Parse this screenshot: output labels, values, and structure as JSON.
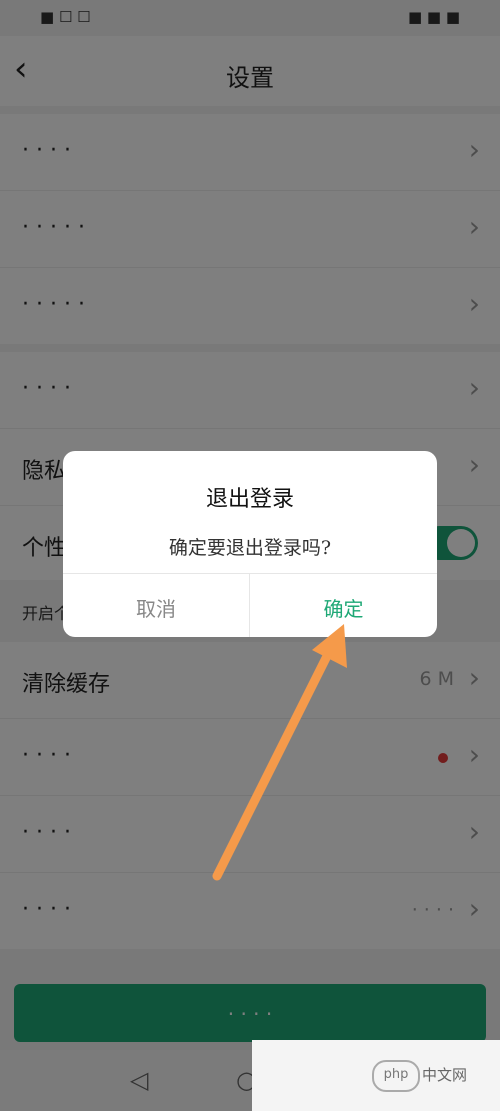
{
  "statusbar": {
    "carrier": "■ ☐ ☐",
    "right": "■ ■ ■"
  },
  "topbar": {
    "title": "设置",
    "back_glyph": "‹"
  },
  "groups": [
    {
      "items": [
        {
          "label": "· · · ·",
          "chevron": "›"
        },
        {
          "label": "· · · · ·",
          "chevron": "›"
        },
        {
          "label": "· · · · ·",
          "chevron": "›"
        }
      ]
    },
    {
      "items": [
        {
          "label": "· · · ·",
          "chevron": "›"
        },
        {
          "label": "隐私",
          "chevron": "›"
        },
        {
          "label": "个性",
          "toggle_on": true
        }
      ]
    }
  ],
  "note": {
    "text": "开启个"
  },
  "cache": {
    "label": "清除缓存",
    "value": "6 M",
    "chevron": "›"
  },
  "groups2": [
    {
      "label": "· · · ·",
      "chevron": "›",
      "dot": true
    },
    {
      "label": "· · · ·",
      "chevron": "›"
    },
    {
      "label": "· · · ·",
      "chevron": "›",
      "value": "· · · ·"
    }
  ],
  "logout_button": {
    "label": "· · · ·"
  },
  "dialog": {
    "title": "退出登录",
    "message": "确定要退出登录吗?",
    "cancel": "取消",
    "confirm": "确定"
  },
  "navbar": {
    "back": "◁",
    "home": "○"
  },
  "watermark": {
    "logo": "php",
    "site": "中文网"
  },
  "colors": {
    "accent": "#1fa876",
    "arrow": "#f59a4a",
    "overlay": "rgba(0,0,0,0.5)"
  }
}
